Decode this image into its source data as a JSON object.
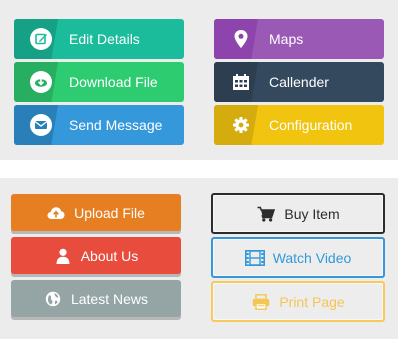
{
  "colors": {
    "green_teal": "#1abc9c",
    "green": "#2ecc71",
    "blue": "#3498db",
    "purple": "#9b59b6",
    "navy": "#34495e",
    "yellow": "#f1c40f",
    "orange": "#e67e22",
    "red": "#e74c3c",
    "gray": "#95a5a6"
  },
  "top_buttons": [
    {
      "label": "Edit Details",
      "icon": "edit-icon"
    },
    {
      "label": "Download File",
      "icon": "download-icon"
    },
    {
      "label": "Send Message",
      "icon": "envelope-icon"
    },
    {
      "label": "Maps",
      "icon": "map-marker-icon"
    },
    {
      "label": "Callender",
      "icon": "calendar-icon"
    },
    {
      "label": "Configuration",
      "icon": "gear-icon"
    }
  ],
  "bottom_buttons": [
    {
      "label": "Upload File",
      "icon": "cloud-upload-icon"
    },
    {
      "label": "About Us",
      "icon": "user-icon"
    },
    {
      "label": "Latest News",
      "icon": "globe-icon"
    },
    {
      "label": "Buy Item",
      "icon": "cart-icon"
    },
    {
      "label": "Watch Video",
      "icon": "film-icon"
    },
    {
      "label": "Print Page",
      "icon": "print-icon"
    }
  ]
}
